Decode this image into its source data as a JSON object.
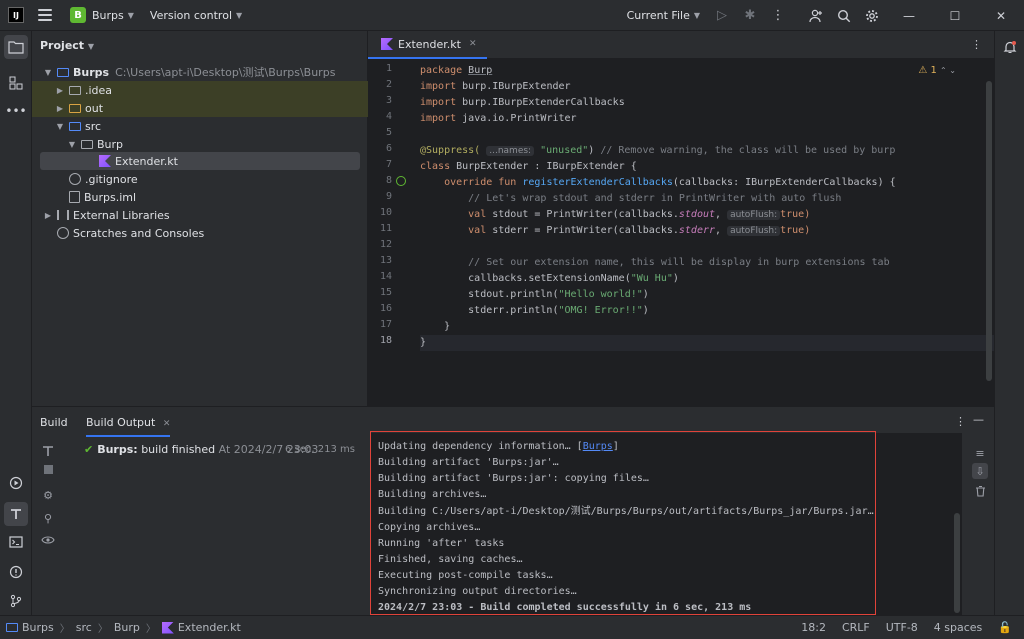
{
  "titlebar": {
    "project_initial": "B",
    "project_name": "Burps",
    "vcs_label": "Version control",
    "run_config": "Current File"
  },
  "project_panel": {
    "title": "Project",
    "root": {
      "name": "Burps",
      "path": "C:\\Users\\apt-i\\Desktop\\测试\\Burps\\Burps"
    },
    "items": [
      {
        "label": ".idea"
      },
      {
        "label": "out"
      },
      {
        "label": "src"
      },
      {
        "label": "Burp"
      },
      {
        "label": "Extender.kt"
      },
      {
        "label": ".gitignore"
      },
      {
        "label": "Burps.iml"
      },
      {
        "label": "External Libraries"
      },
      {
        "label": "Scratches and Consoles"
      }
    ]
  },
  "editor": {
    "tab_label": "Extender.kt",
    "warning_count": "1",
    "line_numbers": [
      "1",
      "2",
      "3",
      "4",
      "5",
      "6",
      "7",
      "8",
      "9",
      "10",
      "11",
      "12",
      "13",
      "14",
      "15",
      "16",
      "17",
      "18"
    ],
    "code": {
      "l1a": "package ",
      "l1b": "Burp",
      "l2a": "import ",
      "l2b": "burp.IBurpExtender",
      "l3a": "import ",
      "l3b": "burp.IBurpExtenderCallbacks",
      "l4a": "import ",
      "l4b": "java.io.PrintWriter",
      "l6a": "@Suppress(",
      "l6hint": "...names:",
      "l6str": "\"unused\"",
      "l6b": ") ",
      "l6cmt": "// Remove warning, the class will be used by burp",
      "l7a": "class ",
      "l7b": "BurpExtender : IBurpExtender {",
      "l8a": "    override fun ",
      "l8fn": "registerExtenderCallbacks",
      "l8b": "(callbacks: IBurpExtenderCallbacks) {",
      "l9cmt": "        // Let's wrap stdout and stderr in PrintWriter with auto flush",
      "l10a": "        val ",
      "l10b": "stdout = PrintWriter(callbacks.",
      "l10i": "stdout",
      "l10c": ", ",
      "l10hint": "autoFlush:",
      "l10d": "true)",
      "l11a": "        val ",
      "l11b": "stderr = PrintWriter(callbacks.",
      "l11i": "stderr",
      "l11c": ", ",
      "l11hint": "autoFlush:",
      "l11d": "true)",
      "l13cmt": "        // Set our extension name, this will be display in burp extensions tab",
      "l14a": "        callbacks.setExtensionName(",
      "l14s": "\"Wu Hu\"",
      "l14b": ")",
      "l15a": "        stdout.println(",
      "l15s": "\"Hello world!\"",
      "l15b": ")",
      "l16a": "        stderr.println(",
      "l16s": "\"OMG! Error!!\"",
      "l16b": ")",
      "l17": "    }",
      "l18": "}"
    }
  },
  "build_panel": {
    "tab_build": "Build",
    "tab_output": "Build Output",
    "result_name": "Burps:",
    "result_text": "build finished",
    "result_time": "At 2024/2/7 23:03",
    "result_duration": "6 sec, 213 ms",
    "output_lines": [
      "Updating dependency information… [",
      "Building artifact 'Burps:jar'…",
      "Building artifact 'Burps:jar': copying files…",
      "Building archives…",
      "Building C:/Users/apt-i/Desktop/测试/Burps/Burps/out/artifacts/Burps_jar/Burps.jar…",
      "Copying archives…",
      "Running 'after' tasks",
      "Finished, saving caches…",
      "Executing post-compile tasks…",
      "Synchronizing output directories…",
      "2024/2/7 23:03 - Build completed successfully in 6 sec, 213 ms"
    ],
    "link_text": "Burps",
    "link_close": "]"
  },
  "statusbar": {
    "crumbs": [
      "Burps",
      "src",
      "Burp",
      "Extender.kt"
    ],
    "position": "18:2",
    "line_sep": "CRLF",
    "encoding": "UTF-8",
    "indent": "4 spaces"
  }
}
